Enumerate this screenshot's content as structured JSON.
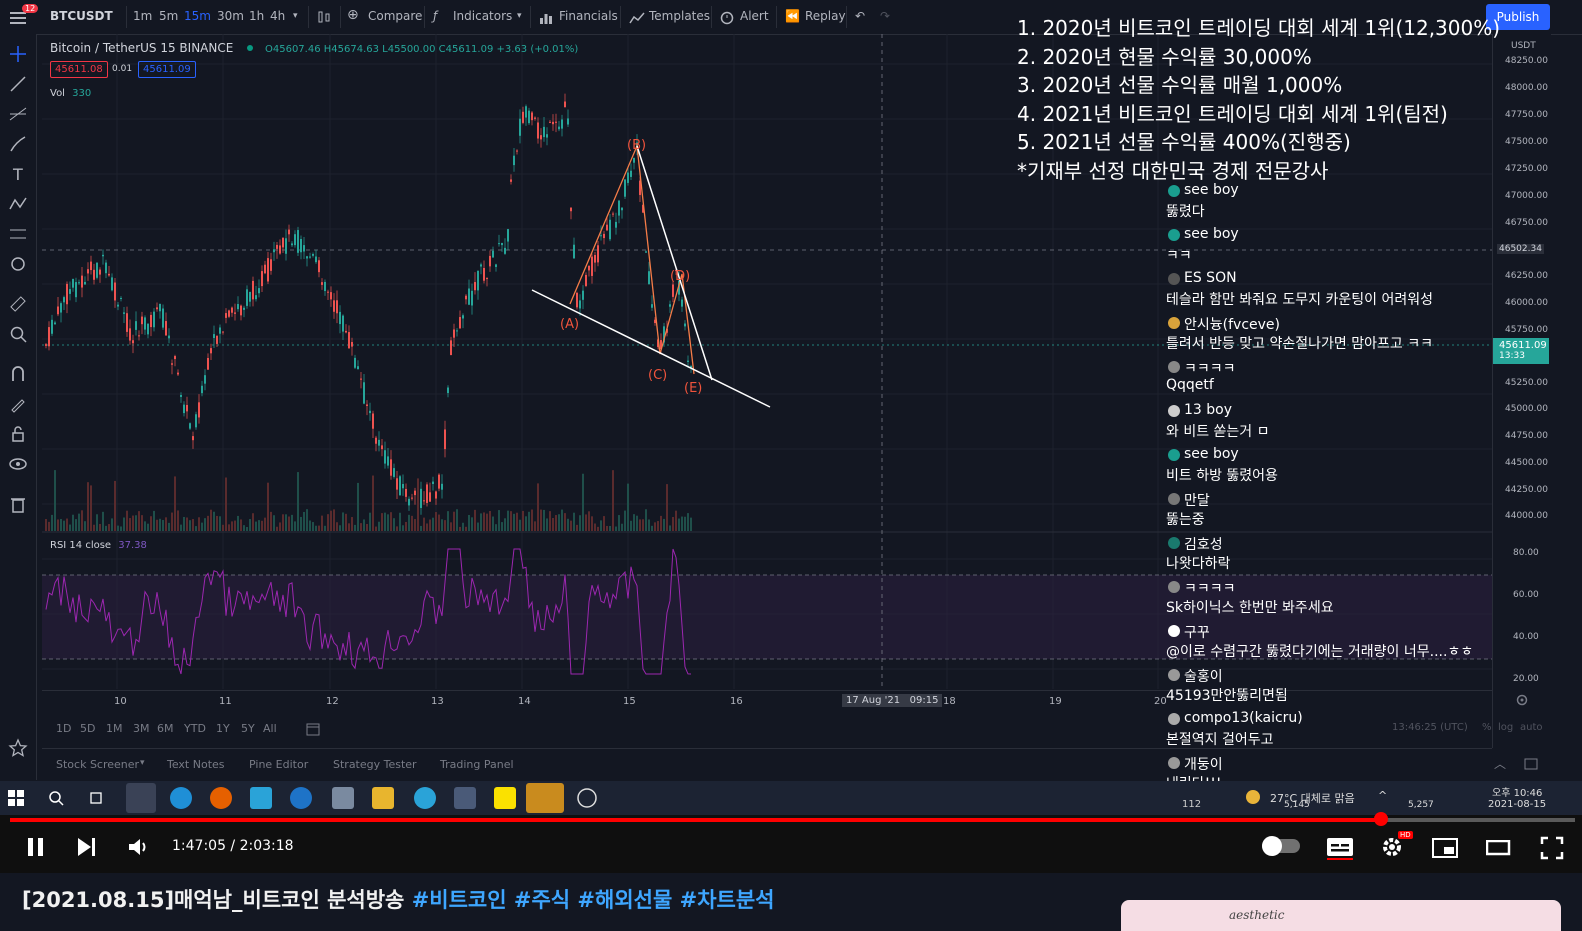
{
  "toolbar": {
    "symbol": "BTCUSDT",
    "intervals": [
      "1m",
      "5m",
      "15m",
      "30m",
      "1h",
      "4h"
    ],
    "active_interval": "15m",
    "compare": "Compare",
    "indicators": "Indicators",
    "financials": "Financials",
    "templates": "Templates",
    "alert": "Alert",
    "replay": "Replay",
    "publish": "Publish",
    "notification_count": "12"
  },
  "legend": {
    "title": "Bitcoin / TetherUS  15  BINANCE",
    "ohlc": "O45607.46 H45674.63 L45500.00 C45611.09 +3.63 (+0.01%)",
    "bid": "45611.08",
    "spread": "0.01",
    "ask": "45611.09",
    "vol_label": "Vol",
    "vol_value": "330",
    "rsi_label": "RSI 14 close",
    "rsi_value": "37.38"
  },
  "price_axis": {
    "currency": "USDT",
    "ticks": [
      "48250.00",
      "48000.00",
      "47750.00",
      "47500.00",
      "47250.00",
      "47000.00",
      "46750.00",
      "46502.34",
      "46250.00",
      "46000.00",
      "45750.00",
      "45611.09",
      "45250.00",
      "45000.00",
      "44750.00",
      "44500.00",
      "44250.00",
      "44000.00"
    ],
    "current_price": "45611.09",
    "countdown": "13:33",
    "rsi_ticks": [
      "80.00",
      "60.00",
      "40.00",
      "20.00"
    ]
  },
  "time_axis": {
    "ticks": [
      "10",
      "11",
      "12",
      "13",
      "14",
      "15",
      "16",
      "17 Aug '21   09:15",
      "18",
      "19",
      "20"
    ],
    "clock": "13:46:25 (UTC)",
    "pct": "%",
    "log": "log",
    "auto": "auto"
  },
  "ranges": [
    "1D",
    "5D",
    "1M",
    "3M",
    "6M",
    "YTD",
    "1Y",
    "5Y",
    "All"
  ],
  "wave_labels": [
    "(A)",
    "(B)",
    "(C)",
    "(D)",
    "(E)"
  ],
  "bottom_tabs": [
    "Stock Screener",
    "Text Notes",
    "Pine Editor",
    "Strategy Tester",
    "Trading Panel"
  ],
  "overlay_lines": [
    "1. 2020년 비트코인 트레이딩 대회 세계 1위(12,300%)",
    "2. 2020년 현물 수익률 30,000%",
    "3. 2020년 선물 수익률 매월 1,000%",
    "4. 2021년 비트코인 트레이딩 대회 세계 1위(팀전)",
    "5. 2021년 선물 수익률 400%(진행중)",
    "*기재부 선정 대한민국 경제 전문강사"
  ],
  "chat": [
    {
      "name": "see boy",
      "text": "뚫렸다",
      "color": "#1a9e8f"
    },
    {
      "name": "see boy",
      "text": "ㅋㅋ",
      "color": "#1a9e8f"
    },
    {
      "name": "ES SON",
      "text": "테슬라 함만 봐줘요 도무지 카운팅이 어려워성",
      "color": "#555555"
    },
    {
      "name": "안시늉(fvceve)",
      "text": "틀려서 반등 맞고 약손절나가면 맘아프고 ㅋㅋ",
      "color": "#d9a33b"
    },
    {
      "name": "ㅋㅋㅋㅋ",
      "text": "Qqqetf",
      "color": "#888888"
    },
    {
      "name": "13 boy",
      "text": "와 비트 쏟는거 ㅁ",
      "color": "#cccccc"
    },
    {
      "name": "see boy",
      "text": "비트 하방 뚫렸어용",
      "color": "#1a9e8f"
    },
    {
      "name": "만달",
      "text": "뚫는중",
      "color": "#777777"
    },
    {
      "name": "김호성",
      "text": "나왓다하락",
      "color": "#1a7a6e"
    },
    {
      "name": "ㅋㅋㅋㅋ",
      "text": "Sk하이닉스 한번만 봐주세요",
      "color": "#888888"
    },
    {
      "name": "구꾸",
      "text": "@이로 수렴구간 뚫렸다기에는 거래량이 너무....ㅎㅎ",
      "color": "#ffffff"
    },
    {
      "name": "술홍이",
      "text": "45193만안뚫리면됨",
      "color": "#999999"
    },
    {
      "name": "compo13(kaicru)",
      "text": "본절역지 걸어두고",
      "color": "#aaaaaa"
    },
    {
      "name": "개둥이",
      "text": "내린다!!!",
      "color": "#999999"
    }
  ],
  "taskbar": {
    "weather": "27°C  대체로 맑음",
    "time": "오후 10:46",
    "date": "2021-08-15",
    "viewers": "112",
    "stat1": "5,145",
    "stat2": "5,257"
  },
  "player": {
    "time": "1:47:05 / 2:03:18",
    "progress": 0.876,
    "hd_badge": "HD"
  },
  "video_title": {
    "main": "[2021.08.15]매억남_비트코인 분석방송 ",
    "tags": "#비트코인 #주식 #해외선물 #차트분석"
  },
  "thumb_text": "aesthetic"
}
